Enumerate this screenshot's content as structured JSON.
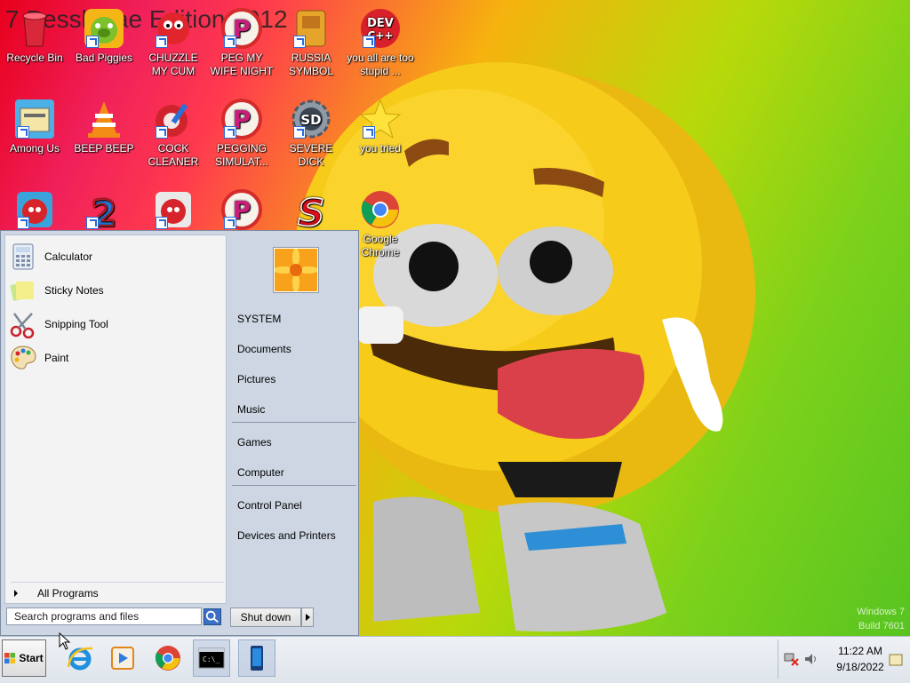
{
  "desktop": {
    "background_title": "7 Pessl... ae Edition 2012",
    "watermark_line1": "Windows 7",
    "watermark_line2": "Build 7601",
    "icons": [
      {
        "label": "Recycle Bin",
        "icon": "recycle-bin-icon"
      },
      {
        "label": "Bad Piggies",
        "icon": "bad-piggies-icon"
      },
      {
        "label": "CHUZZLE MY CUM",
        "icon": "chuzzle-icon"
      },
      {
        "label": "PEG MY WIFE NIGHT",
        "icon": "peggle-icon"
      },
      {
        "label": "RUSSIA SYMBOL",
        "icon": "russia-symbol-icon"
      },
      {
        "label": "you all are too stupid ...",
        "icon": "devcpp-icon"
      },
      {
        "label": "Among Us",
        "icon": "among-us-icon"
      },
      {
        "label": "BEEP BEEP",
        "icon": "vlc-cone-icon"
      },
      {
        "label": "COCK CLEANER",
        "icon": "ccleaner-icon"
      },
      {
        "label": "PEGGING SIMULAT...",
        "icon": "peggle-icon"
      },
      {
        "label": "SEVERE DICK",
        "icon": "sd-gear-icon"
      },
      {
        "label": "you tried",
        "icon": "star-icon"
      },
      {
        "label": "",
        "icon": "angry-birds-icon"
      },
      {
        "label": "",
        "icon": "number-two-icon"
      },
      {
        "label": "",
        "icon": "angry-birds-icon"
      },
      {
        "label": "",
        "icon": "peggle-icon"
      },
      {
        "label": "",
        "icon": "s-logo-icon"
      },
      {
        "label": "Google Chrome",
        "icon": "chrome-icon"
      }
    ]
  },
  "start_menu": {
    "programs": [
      {
        "label": "Calculator",
        "icon": "calculator-icon"
      },
      {
        "label": "Sticky Notes",
        "icon": "sticky-notes-icon"
      },
      {
        "label": "Snipping Tool",
        "icon": "scissors-icon"
      },
      {
        "label": "Paint",
        "icon": "paint-palette-icon"
      }
    ],
    "all_programs": "All Programs",
    "search_placeholder": "Search programs and files",
    "right_links": [
      "SYSTEM",
      "Documents",
      "Pictures",
      "Music",
      "Games",
      "Computer",
      "Control Panel",
      "Devices and Printers"
    ],
    "shutdown_label": "Shut down"
  },
  "taskbar": {
    "start_label": "Start",
    "apps": [
      "internet-explorer-icon",
      "media-player-icon",
      "chrome-icon",
      "command-prompt-icon",
      "phone-app-icon"
    ],
    "time": "11:22 AM",
    "date": "9/18/2022"
  },
  "colors": {
    "start_menu_bg": "#cdd6e2",
    "taskbar_bg": "#e6ebf1",
    "accent_blue": "#3c70c6"
  }
}
